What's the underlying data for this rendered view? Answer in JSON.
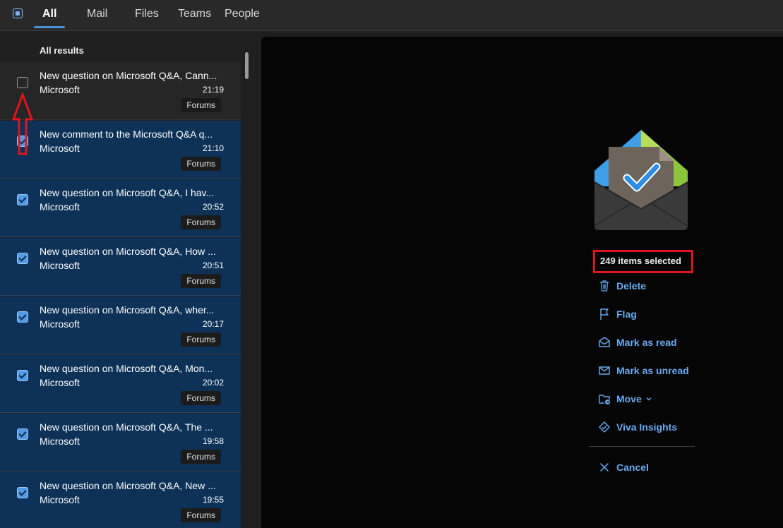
{
  "tabs": {
    "all": "All",
    "mail": "Mail",
    "files": "Files",
    "teams": "Teams",
    "people": "People"
  },
  "list": {
    "header": "All results",
    "rows": [
      {
        "subject": "New question on Microsoft Q&A, Cann...",
        "sender": "Microsoft",
        "time": "21:19",
        "tag": "Forums",
        "selected": false
      },
      {
        "subject": "New comment to the Microsoft Q&A q...",
        "sender": "Microsoft",
        "time": "21:10",
        "tag": "Forums",
        "selected": true
      },
      {
        "subject": "New question on Microsoft Q&A, I hav...",
        "sender": "Microsoft",
        "time": "20:52",
        "tag": "Forums",
        "selected": true
      },
      {
        "subject": "New question on Microsoft Q&A, How ...",
        "sender": "Microsoft",
        "time": "20:51",
        "tag": "Forums",
        "selected": true
      },
      {
        "subject": "New question on Microsoft Q&A, wher...",
        "sender": "Microsoft",
        "time": "20:17",
        "tag": "Forums",
        "selected": true
      },
      {
        "subject": "New question on Microsoft Q&A, Mon...",
        "sender": "Microsoft",
        "time": "20:02",
        "tag": "Forums",
        "selected": true
      },
      {
        "subject": "New question on Microsoft Q&A, The ...",
        "sender": "Microsoft",
        "time": "19:58",
        "tag": "Forums",
        "selected": true
      },
      {
        "subject": "New question on Microsoft Q&A, New ...",
        "sender": "Microsoft",
        "time": "19:55",
        "tag": "Forums",
        "selected": true
      }
    ]
  },
  "pane": {
    "selected_count": "249 items selected",
    "actions": {
      "delete": "Delete",
      "flag": "Flag",
      "mark_read": "Mark as read",
      "mark_unread": "Mark as unread",
      "move": "Move",
      "viva": "Viva Insights",
      "cancel": "Cancel"
    }
  },
  "colors": {
    "accent": "#4a8fd8",
    "action_text": "#6aabf2",
    "selected_row": "#0d3157",
    "annotation_red": "#e0161b"
  }
}
